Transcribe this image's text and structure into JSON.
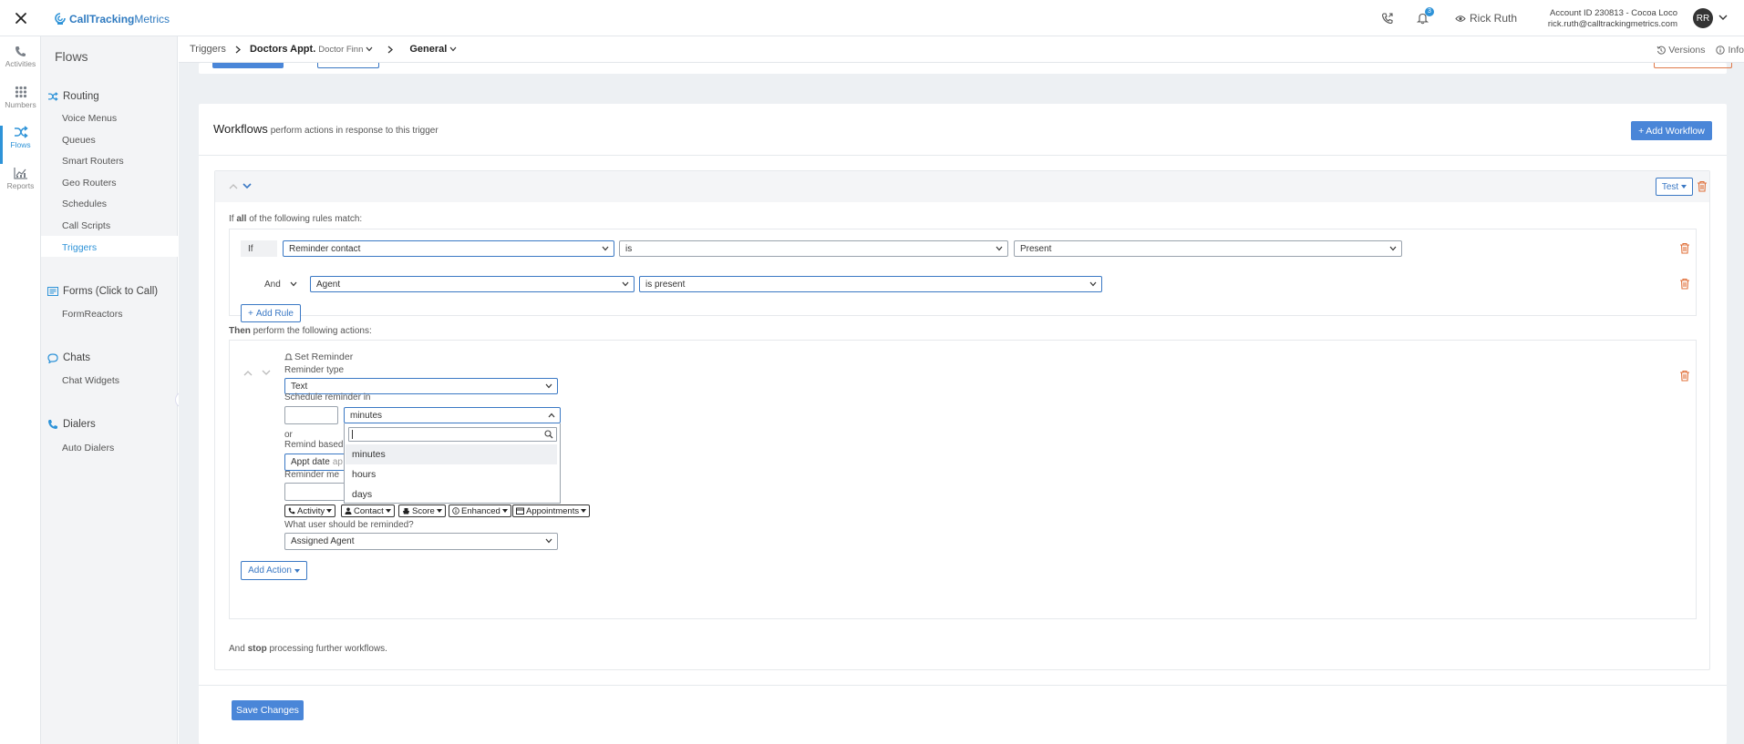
{
  "brand": {
    "name_bold": "CallTracking",
    "name_regular": "Metrics",
    "accent": "#2e93d8"
  },
  "header": {
    "notification_count": "3",
    "user_name": "Rick Ruth",
    "account_line": "Account ID 230813  -  Cocoa Loco",
    "email": "rick.ruth@calltrackingmetrics.com",
    "avatar_initials": "RR"
  },
  "rail": [
    {
      "label": "Activities",
      "icon": "phone-icon"
    },
    {
      "label": "Numbers",
      "icon": "grid-icon"
    },
    {
      "label": "Flows",
      "icon": "shuffle-icon"
    },
    {
      "label": "Reports",
      "icon": "chart-icon"
    }
  ],
  "sidebar": {
    "title": "Flows",
    "routing": {
      "label": "Routing",
      "items": [
        "Voice Menus",
        "Queues",
        "Smart Routers",
        "Geo Routers",
        "Schedules",
        "Call Scripts",
        "Triggers"
      ]
    },
    "forms": {
      "label": "Forms (Click to Call)",
      "items": [
        "FormReactors"
      ]
    },
    "chats": {
      "label": "Chats",
      "items": [
        "Chat Widgets"
      ]
    },
    "dialers": {
      "label": "Dialers",
      "items": [
        "Auto Dialers"
      ]
    }
  },
  "breadcrumb": {
    "root": "Triggers",
    "trigger_name": "Doctors Appt.",
    "trigger_sub": "Doctor Finn",
    "section": "General",
    "versions": "Versions",
    "info": "Info"
  },
  "workflows": {
    "title": "Workflows",
    "subtitle": "perform actions in response to this trigger",
    "add_button": "Add Workflow",
    "test_button": "Test",
    "rules_intro_pre": "If",
    "rules_intro_bold": "all",
    "rules_intro_post": "of the following rules match:",
    "rule1": {
      "prefix": "If",
      "field": "Reminder contact",
      "operator": "is",
      "value": "Present"
    },
    "rule2": {
      "prefix": "And",
      "field": "Agent",
      "operator": "is present"
    },
    "add_rule": "Add Rule",
    "actions_intro_bold": "Then",
    "actions_intro_post": "perform the following actions:",
    "action": {
      "title": "Set Reminder",
      "type_label": "Reminder type",
      "type_value": "Text",
      "schedule_label": "Schedule reminder in",
      "unit_value": "minutes",
      "unit_options": [
        "minutes",
        "hours",
        "days"
      ],
      "or_label": "or",
      "remind_based_label": "Remind based",
      "appt_value": "Appt date",
      "appt_suffix": "ap",
      "message_label": "Reminder me",
      "tokens": [
        "Activity",
        "Contact",
        "Score",
        "Enhanced",
        "Appointments"
      ],
      "user_label": "What user should be reminded?",
      "user_value": "Assigned Agent"
    },
    "add_action": "Add Action",
    "stop_pre": "And",
    "stop_bold": "stop",
    "stop_post": "processing further workflows.",
    "save": "Save Changes"
  }
}
